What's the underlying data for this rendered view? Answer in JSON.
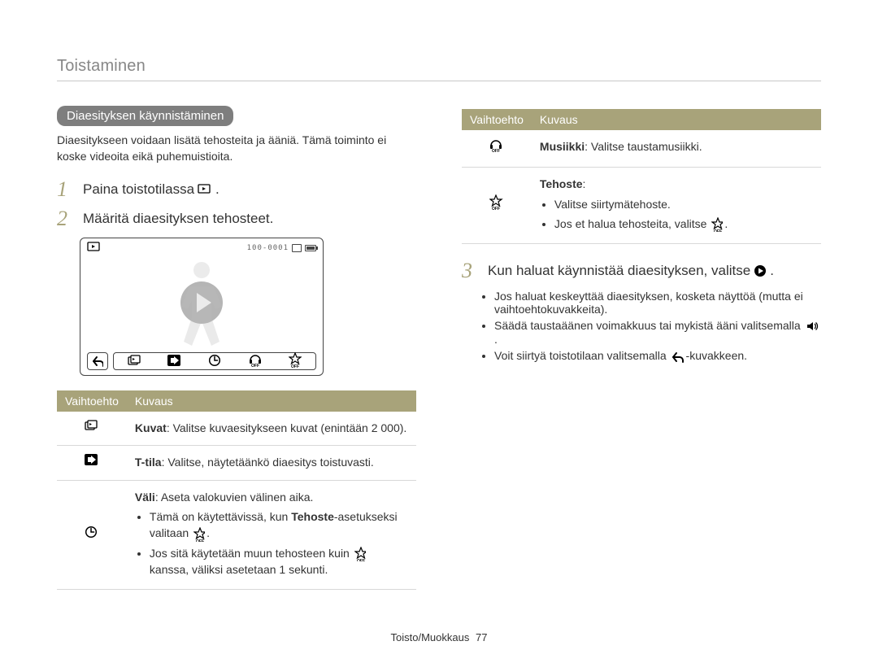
{
  "header": "Toistaminen",
  "section_tag": "Diaesityksen käynnistäminen",
  "intro": "Diaesitykseen voidaan lisätä tehosteita ja ääniä. Tämä toiminto ei koske videoita eikä puhemuistioita.",
  "steps": {
    "s1": {
      "num": "1",
      "text_before": "Paina toistotilassa ",
      "icon": "slideshow-icon",
      "text_after": "."
    },
    "s2": {
      "num": "2",
      "text": "Määritä diaesityksen tehosteet."
    },
    "s3": {
      "num": "3",
      "text_before": "Kun haluat käynnistää diaesityksen, valitse ",
      "icon": "play-circle-icon",
      "text_after": "."
    }
  },
  "screen": {
    "file_id": "100-0001",
    "toolbar_icons": [
      "images-icon",
      "arrow-right-icon",
      "clock-icon",
      "headphones-off-icon",
      "star-off-icon"
    ]
  },
  "table_left": {
    "header_option": "Vaihtoehto",
    "header_desc": "Kuvaus",
    "rows": [
      {
        "icon": "images-icon",
        "title": "Kuvat",
        "desc_after": ": Valitse kuvaesitykseen kuvat (enintään 2 000)."
      },
      {
        "icon": "arrow-right-icon",
        "title": "T-tila",
        "desc_after": ": Valitse, näytetäänkö diaesitys toistuvasti."
      },
      {
        "icon": "clock-icon",
        "title": "Väli",
        "desc_after": ": Aseta valokuvien välinen aika.",
        "bullets": [
          {
            "pre": "Tämä on käytettävissä, kun ",
            "bold": "Tehoste",
            "mid": "-asetukseksi valitaan ",
            "icon": "star-off-icon",
            "post": "."
          },
          {
            "pre": "Jos sitä käytetään muun tehosteen kuin ",
            "icon": "star-off-icon",
            "post": " kanssa, väliksi asetetaan 1 sekunti."
          }
        ]
      }
    ]
  },
  "table_right": {
    "header_option": "Vaihtoehto",
    "header_desc": "Kuvaus",
    "rows": [
      {
        "icon": "headphones-off-icon",
        "title": "Musiikki",
        "desc_after": ": Valitse taustamusiikki."
      },
      {
        "icon": "star-off-icon",
        "title": "Tehoste",
        "desc_after": ":",
        "bullets": [
          {
            "text": "Valitse siirtymätehoste."
          },
          {
            "pre": "Jos et halua tehosteita, valitse ",
            "icon": "star-off-icon",
            "post": "."
          }
        ]
      }
    ]
  },
  "step3_bullets": [
    "Jos haluat keskeyttää diaesityksen, kosketa näyttöä (mutta ei vaihtoehtokuvakkeita).",
    {
      "pre": "Säädä taustaäänen voimakkuus tai mykistä ääni valitsemalla ",
      "icon": "speaker-icon",
      "post": "."
    },
    {
      "pre": "Voit siirtyä toistotilaan valitsemalla ",
      "icon": "back-arrow-icon",
      "post": "-kuvakkeen."
    }
  ],
  "footer": {
    "section": "Toisto/Muokkaus",
    "page": "77"
  }
}
